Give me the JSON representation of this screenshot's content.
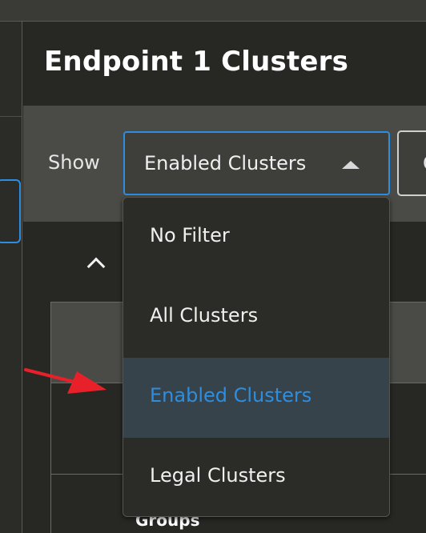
{
  "header": {
    "title": "Endpoint 1 Clusters"
  },
  "filter": {
    "show_label": "Show",
    "selected_value": "Enabled Clusters",
    "second_button_text": "C"
  },
  "dropdown": {
    "options": [
      {
        "label": "No Filter",
        "selected": false
      },
      {
        "label": "All Clusters",
        "selected": false
      },
      {
        "label": "Enabled Clusters",
        "selected": true
      },
      {
        "label": "Legal Clusters",
        "selected": false
      }
    ]
  },
  "table": {
    "partial_label": "Groups"
  },
  "icons": {
    "caret": "caret-up-icon",
    "chevron": "chevron-up-icon",
    "annotation": "red-arrow-annotation"
  },
  "colors": {
    "accent": "#2d8ee0",
    "selected_row_bg": "#37434b",
    "annotation": "#e8202a",
    "background": "#272824",
    "filter_bar_bg": "#4a4b47"
  }
}
